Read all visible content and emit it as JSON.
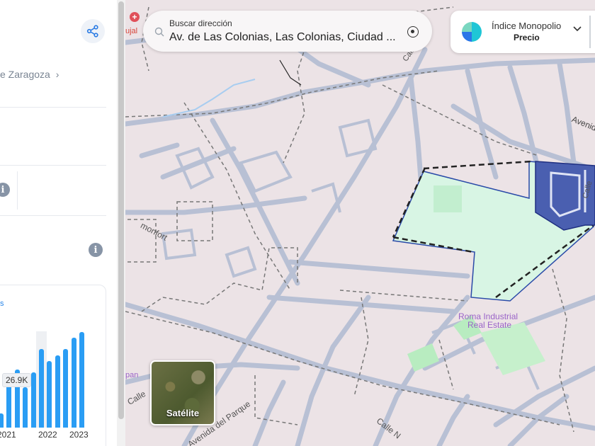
{
  "left_panel": {
    "breadcrumb": "e Zaragoza",
    "chart": {
      "legend_fragment": "s",
      "tooltip": "26.9K",
      "x_labels": [
        "2021",
        "2022",
        "2023"
      ]
    }
  },
  "chart_data": {
    "type": "bar",
    "values": [
      5,
      17,
      20,
      14,
      19,
      27,
      23,
      25,
      27,
      31,
      33
    ],
    "highlighted_label": "26.9K",
    "x_ticks": [
      "2021",
      "2022",
      "2023"
    ]
  },
  "search": {
    "label": "Buscar dirección",
    "value": "Av. de Las Colonias, Las Colonias, Ciudad ..."
  },
  "index_selector": {
    "title": "Índice Monopolio",
    "subtitle": "Precio"
  },
  "map": {
    "satellite_label": "Satélite",
    "labels": {
      "granjas": "Avenida De Las Granjas",
      "roma": "Roma Industrial",
      "real_estate": "Real Estate",
      "monfort": "monfort",
      "parque": "Avenida del Parque",
      "calle_left": "Calle",
      "calle_bottom": "Calle N",
      "pan": "pan",
      "top_road": "Calzetrel",
      "right_road": "Calle",
      "poi_top": "ujal"
    },
    "colors": {
      "road": "#b8c0d4",
      "park_fill": "#d8f5e4",
      "property_fill": "#4a5fb0"
    }
  }
}
